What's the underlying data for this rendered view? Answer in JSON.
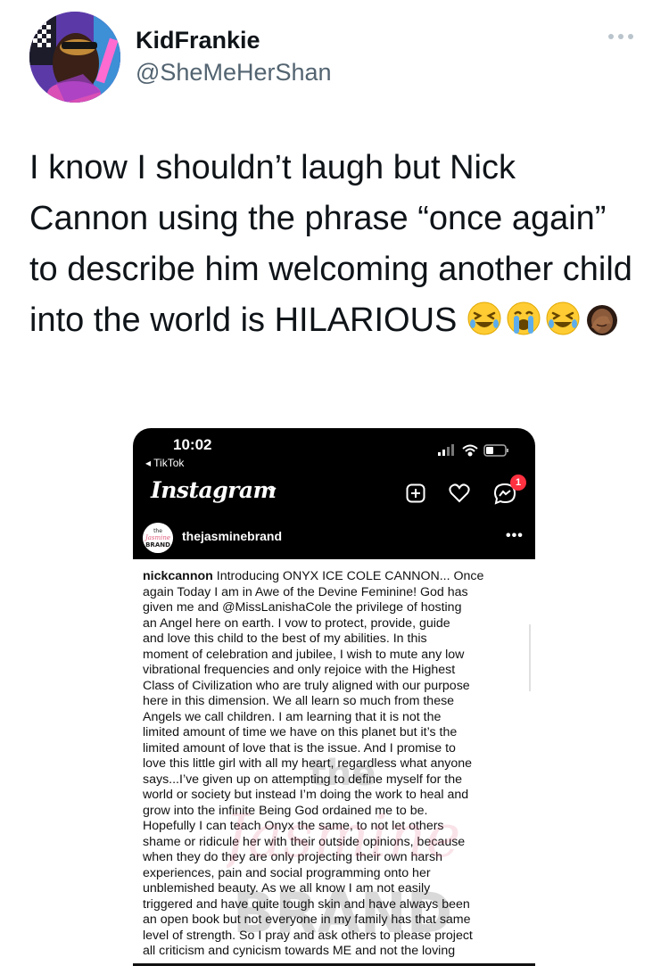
{
  "tweet": {
    "display_name": "KidFrankie",
    "handle": "@SheMeHerShan",
    "text": "I know I shouldn’t laugh but Nick Cannon using the phrase “once again” to describe him welcoming another child into the world is HILARIOUS",
    "emojis": [
      "rolling-on-floor-laughing",
      "loudly-crying-face",
      "rolling-on-floor-laughing",
      "woman-facepalming"
    ]
  },
  "screenshot": {
    "time": "10:02",
    "back_app": "◂ TikTok",
    "app_name": "Instagram",
    "notification_count": "1",
    "account_name": "thejasminebrand",
    "account_logo_text": "the Jasmine BRAND",
    "more": "•••",
    "caption_user": "nickcannon",
    "caption_text": " Introducing ONYX ICE COLE CANNON... Once\nagain Today I am in Awe of the Devine Feminine! God has\ngiven me and @MissLanishaCole the privilege of hosting\nan Angel here on earth. I vow to protect, provide, guide\nand love this child to the best of my abilities. In this\nmoment of celebration and jubilee, I wish to mute any low\nvibrational frequencies and only rejoice with the Highest\nClass of Civilization who are truly aligned with our purpose\nhere in this dimension. We all learn so much from these\nAngels we call children. I am learning that it is not the\nlimited amount of time we have on this planet but it’s the\nlimited amount of love that is the issue. And I promise to\nlove this little girl with all my heart, regardless what anyone\nsays...I’ve given up on attempting to define myself for the\nworld or society but instead I’m doing the work to heal and\ngrow into the infinite Being God ordained me to be.\nHopefully I can teach Onyx the same, to not let others\nshame or ridicule her with their outside opinions, because\nwhen they do they are only projecting their own harsh\nexperiences, pain and social programming onto her\nunblemished beauty. As we all know I am not easily\ntriggered and have quite tough skin and have always been\nan open book but not everyone in my family has that same\nlevel of strength. So I pray and ask others to please project\nall criticism and cynicism towards ME and not the loving",
    "watermark_text": "the Jasmine BRAND"
  },
  "colors": {
    "text": "#0f1419",
    "secondary": "#536471",
    "badge": "#ff3040",
    "watermark": "#e0607f"
  }
}
